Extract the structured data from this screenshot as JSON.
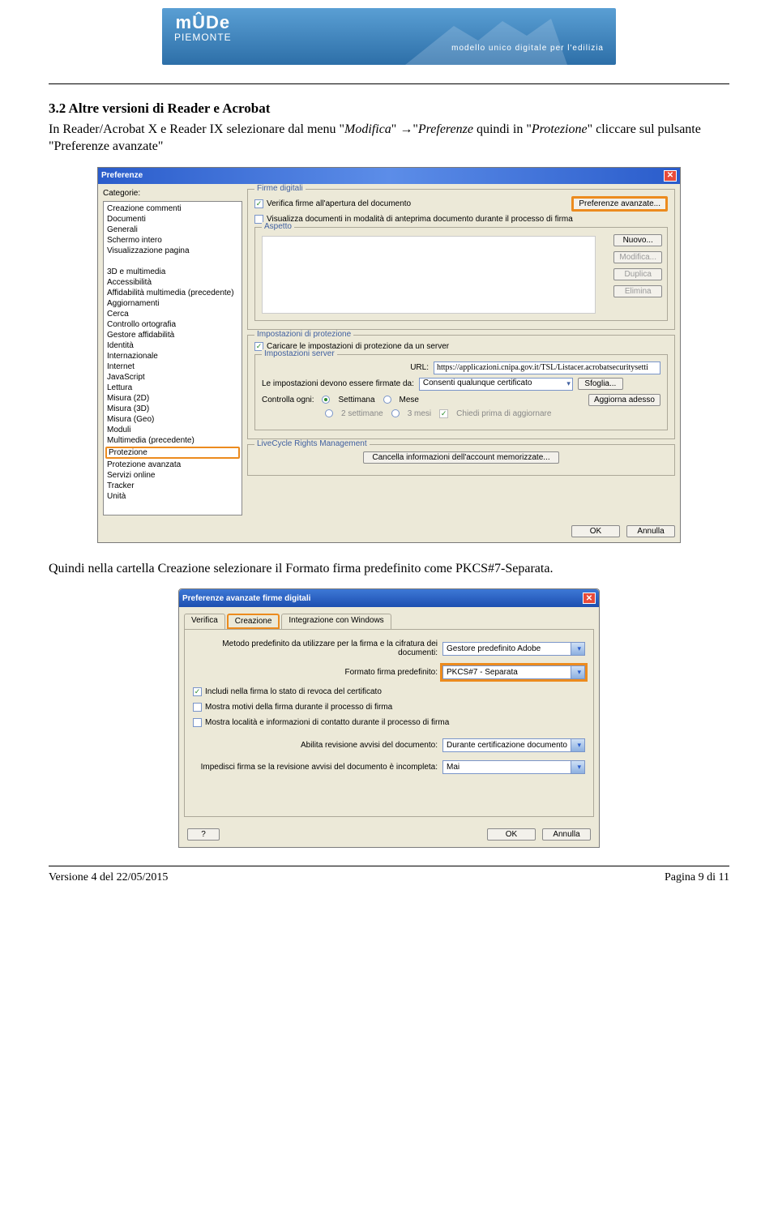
{
  "logo": {
    "main": "mÛDe",
    "sub": "PIEMONTE",
    "tagline": "modello unico digitale per l'edilizia"
  },
  "section": {
    "title": "3.2 Altre versioni di Reader e Acrobat",
    "para1_a": "In Reader/Acrobat X e Reader IX selezionare dal menu \"",
    "para1_i1": "Modifica",
    "para1_b": "\" →\"",
    "para1_i2": "Preferenze",
    "para1_c": " quindi in \"",
    "para1_i3": "Protezione",
    "para1_d": "\" cliccare sul pulsante \"Preferenze avanzate\"",
    "para2": "Quindi nella cartella Creazione selezionare il Formato firma predefinito come PKCS#7-Separata."
  },
  "shot1": {
    "title": "Preferenze",
    "categories_label": "Categorie:",
    "categories": [
      "Creazione commenti",
      "Documenti",
      "Generali",
      "Schermo intero",
      "Visualizzazione pagina",
      "",
      "3D e multimedia",
      "Accessibilità",
      "Affidabilità multimedia (precedente)",
      "Aggiornamenti",
      "Cerca",
      "Controllo ortografia",
      "Gestore affidabilità",
      "Identità",
      "Internazionale",
      "Internet",
      "JavaScript",
      "Lettura",
      "Misura (2D)",
      "Misura (3D)",
      "Misura (Geo)",
      "Moduli",
      "Multimedia (precedente)",
      "Protezione",
      "Protezione avanzata",
      "Servizi online",
      "Tracker",
      "Unità"
    ],
    "highlight_index": 23,
    "firme": {
      "legend": "Firme digitali",
      "chk1": "Verifica firme all'apertura del documento",
      "chk2": "Visualizza documenti in modalità di anteprima documento durante il processo di firma",
      "btn_adv": "Preferenze avanzate..."
    },
    "aspetto": {
      "legend": "Aspetto",
      "btn_new": "Nuovo...",
      "btn_mod": "Modifica...",
      "btn_dup": "Duplica",
      "btn_del": "Elimina"
    },
    "impost": {
      "legend": "Impostazioni di protezione",
      "chk": "Caricare le impostazioni di protezione da un server",
      "sub_legend": "Impostazioni server",
      "url_label": "URL:",
      "url_value": "https://applicazioni.cnipa.gov.it/TSL/Listacer.acrobatsecuritysetti",
      "sign_label": "Le impostazioni devono essere firmate da:",
      "sign_value": "Consenti qualunque certificato",
      "browse": "Sfoglia...",
      "check_label": "Controlla ogni:",
      "r1": "Settimana",
      "r2": "Mese",
      "r3": "2 settimane",
      "r4": "3 mesi",
      "chk_ask": "Chiedi prima di aggiornare",
      "btn_update": "Aggiorna adesso"
    },
    "lc": {
      "legend": "LiveCycle Rights Management",
      "btn": "Cancella informazioni dell'account memorizzate..."
    },
    "ok": "OK",
    "cancel": "Annulla"
  },
  "shot2": {
    "title": "Preferenze avanzate firme digitali",
    "tabs": {
      "t1": "Verifica",
      "t2": "Creazione",
      "t3": "Integrazione con Windows"
    },
    "row1_label": "Metodo predefinito da utilizzare per la firma e la cifratura dei documenti:",
    "row1_value": "Gestore predefinito Adobe",
    "row2_label": "Formato firma predefinito:",
    "row2_value": "PKCS#7 - Separata",
    "chk1": "Includi nella firma lo stato di revoca del certificato",
    "chk2": "Mostra motivi della firma durante il processo di firma",
    "chk3": "Mostra località e informazioni di contatto durante il processo di firma",
    "row3_label": "Abilita revisione avvisi del documento:",
    "row3_value": "Durante certificazione documento",
    "row4_label": "Impedisci firma se la revisione avvisi del documento è incompleta:",
    "row4_value": "Mai",
    "help": "?",
    "ok": "OK",
    "cancel": "Annulla"
  },
  "footer": {
    "left": "Versione 4  del 22/05/2015",
    "right": "Pagina 9 di 11"
  }
}
